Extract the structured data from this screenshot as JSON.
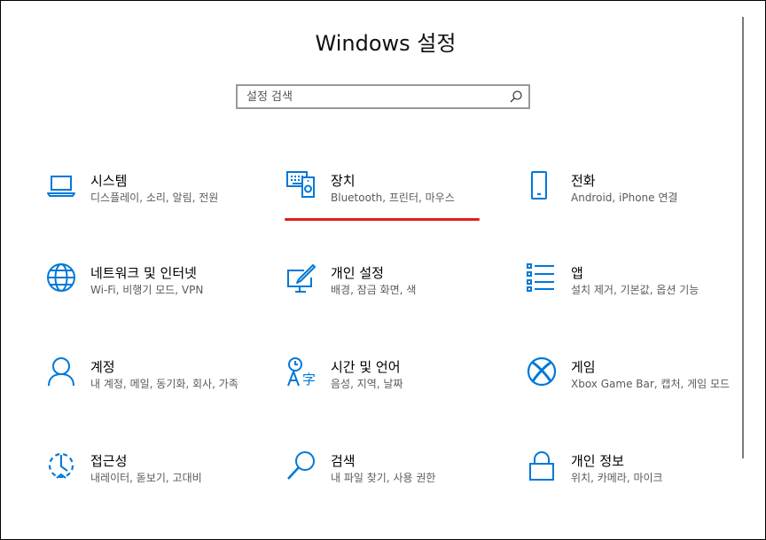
{
  "window": {
    "title": "Windows 설정"
  },
  "search": {
    "placeholder": "설정 검색"
  },
  "categories": [
    {
      "label": "시스템",
      "desc": "디스플레이, 소리, 알림, 전원",
      "icon": "laptop-icon"
    },
    {
      "label": "장치",
      "desc": "Bluetooth, 프린터, 마우스",
      "icon": "devices-icon"
    },
    {
      "label": "전화",
      "desc": "Android, iPhone 연결",
      "icon": "phone-icon"
    },
    {
      "label": "네트워크 및 인터넷",
      "desc": "Wi-Fi, 비행기 모드, VPN",
      "icon": "globe-icon"
    },
    {
      "label": "개인 설정",
      "desc": "배경, 잠금 화면, 색",
      "icon": "personalization-icon"
    },
    {
      "label": "앱",
      "desc": "설치 제거, 기본값, 옵션 기능",
      "icon": "apps-icon"
    },
    {
      "label": "계정",
      "desc": "내 계정, 메일, 동기화, 회사, 가족",
      "icon": "person-icon"
    },
    {
      "label": "시간 및 언어",
      "desc": "음성, 지역, 날짜",
      "icon": "time-language-icon"
    },
    {
      "label": "게임",
      "desc": "Xbox Game Bar, 캡처, 게임 모드",
      "icon": "xbox-icon"
    },
    {
      "label": "접근성",
      "desc": "내레이터, 돋보기, 고대비",
      "icon": "accessibility-icon"
    },
    {
      "label": "검색",
      "desc": "내 파일 찾기, 사용 권한",
      "icon": "search-category-icon"
    },
    {
      "label": "개인 정보",
      "desc": "위치, 카메라, 마이크",
      "icon": "lock-icon"
    }
  ],
  "colors": {
    "accent": "#0078d7",
    "highlight": "#e01e1e"
  }
}
